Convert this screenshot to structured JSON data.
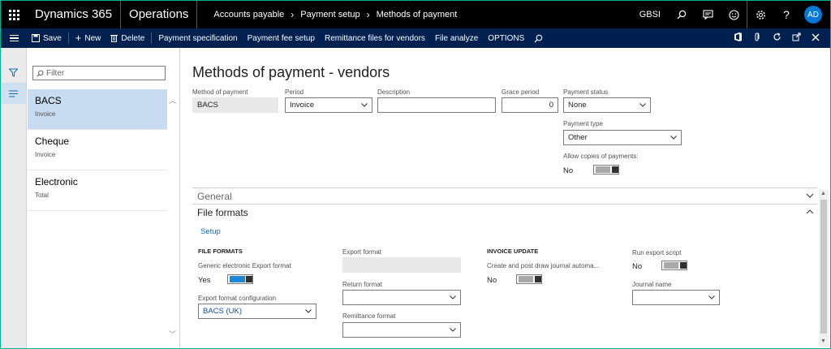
{
  "navbar": {
    "brand": "Dynamics 365",
    "module": "Operations",
    "breadcrumbs": [
      "Accounts payable",
      "Payment setup",
      "Methods of payment"
    ],
    "company": "GBSI",
    "avatar": "AD",
    "icons": [
      "waffle-icon",
      "search-icon",
      "message-icon",
      "smiley-icon",
      "gear-icon",
      "help-icon"
    ]
  },
  "actionbar": {
    "save": "Save",
    "new": "New",
    "delete": "Delete",
    "items": [
      "Payment specification",
      "Payment fee setup",
      "Remittance files for vendors",
      "File analyze",
      "OPTIONS"
    ],
    "right_icons": [
      "office-icon",
      "attach-icon",
      "refresh-icon",
      "open-new-icon",
      "close-icon"
    ]
  },
  "list": {
    "filter_placeholder": "Filter",
    "items": [
      {
        "title": "BACS",
        "sub": "Invoice"
      },
      {
        "title": "Cheque",
        "sub": "Invoice"
      },
      {
        "title": "Electronic",
        "sub": "Total"
      }
    ]
  },
  "page": {
    "title": "Methods of payment - vendors",
    "method_label": "Method of payment",
    "method_value": "BACS",
    "period_label": "Period",
    "period_value": "Invoice",
    "description_label": "Description",
    "description_value": "",
    "grace_label": "Grace period",
    "grace_value": "0",
    "status_label": "Payment status",
    "status_value": "None",
    "type_label": "Payment type",
    "type_value": "Other",
    "copies_label": "Allow copies of payments:",
    "copies_value": "No"
  },
  "tabs": {
    "general": "General",
    "file_formats": "File formats"
  },
  "file_formats": {
    "setup_link": "Setup",
    "group1": "FILE FORMATS",
    "generic_label": "Generic electronic Export format",
    "generic_value": "Yes",
    "config_label": "Export format configuration",
    "config_value": "BACS (UK)",
    "export_format_label": "Export format",
    "export_format_value": "",
    "return_format_label": "Return format",
    "return_format_value": "",
    "remittance_label": "Remittance format",
    "remittance_value": "",
    "group2": "INVOICE UPDATE",
    "create_post_label": "Create and post draw journal automa...",
    "create_post_value": "No",
    "run_script_label": "Run export script",
    "run_script_value": "No",
    "journal_label": "Journal name",
    "journal_value": ""
  }
}
